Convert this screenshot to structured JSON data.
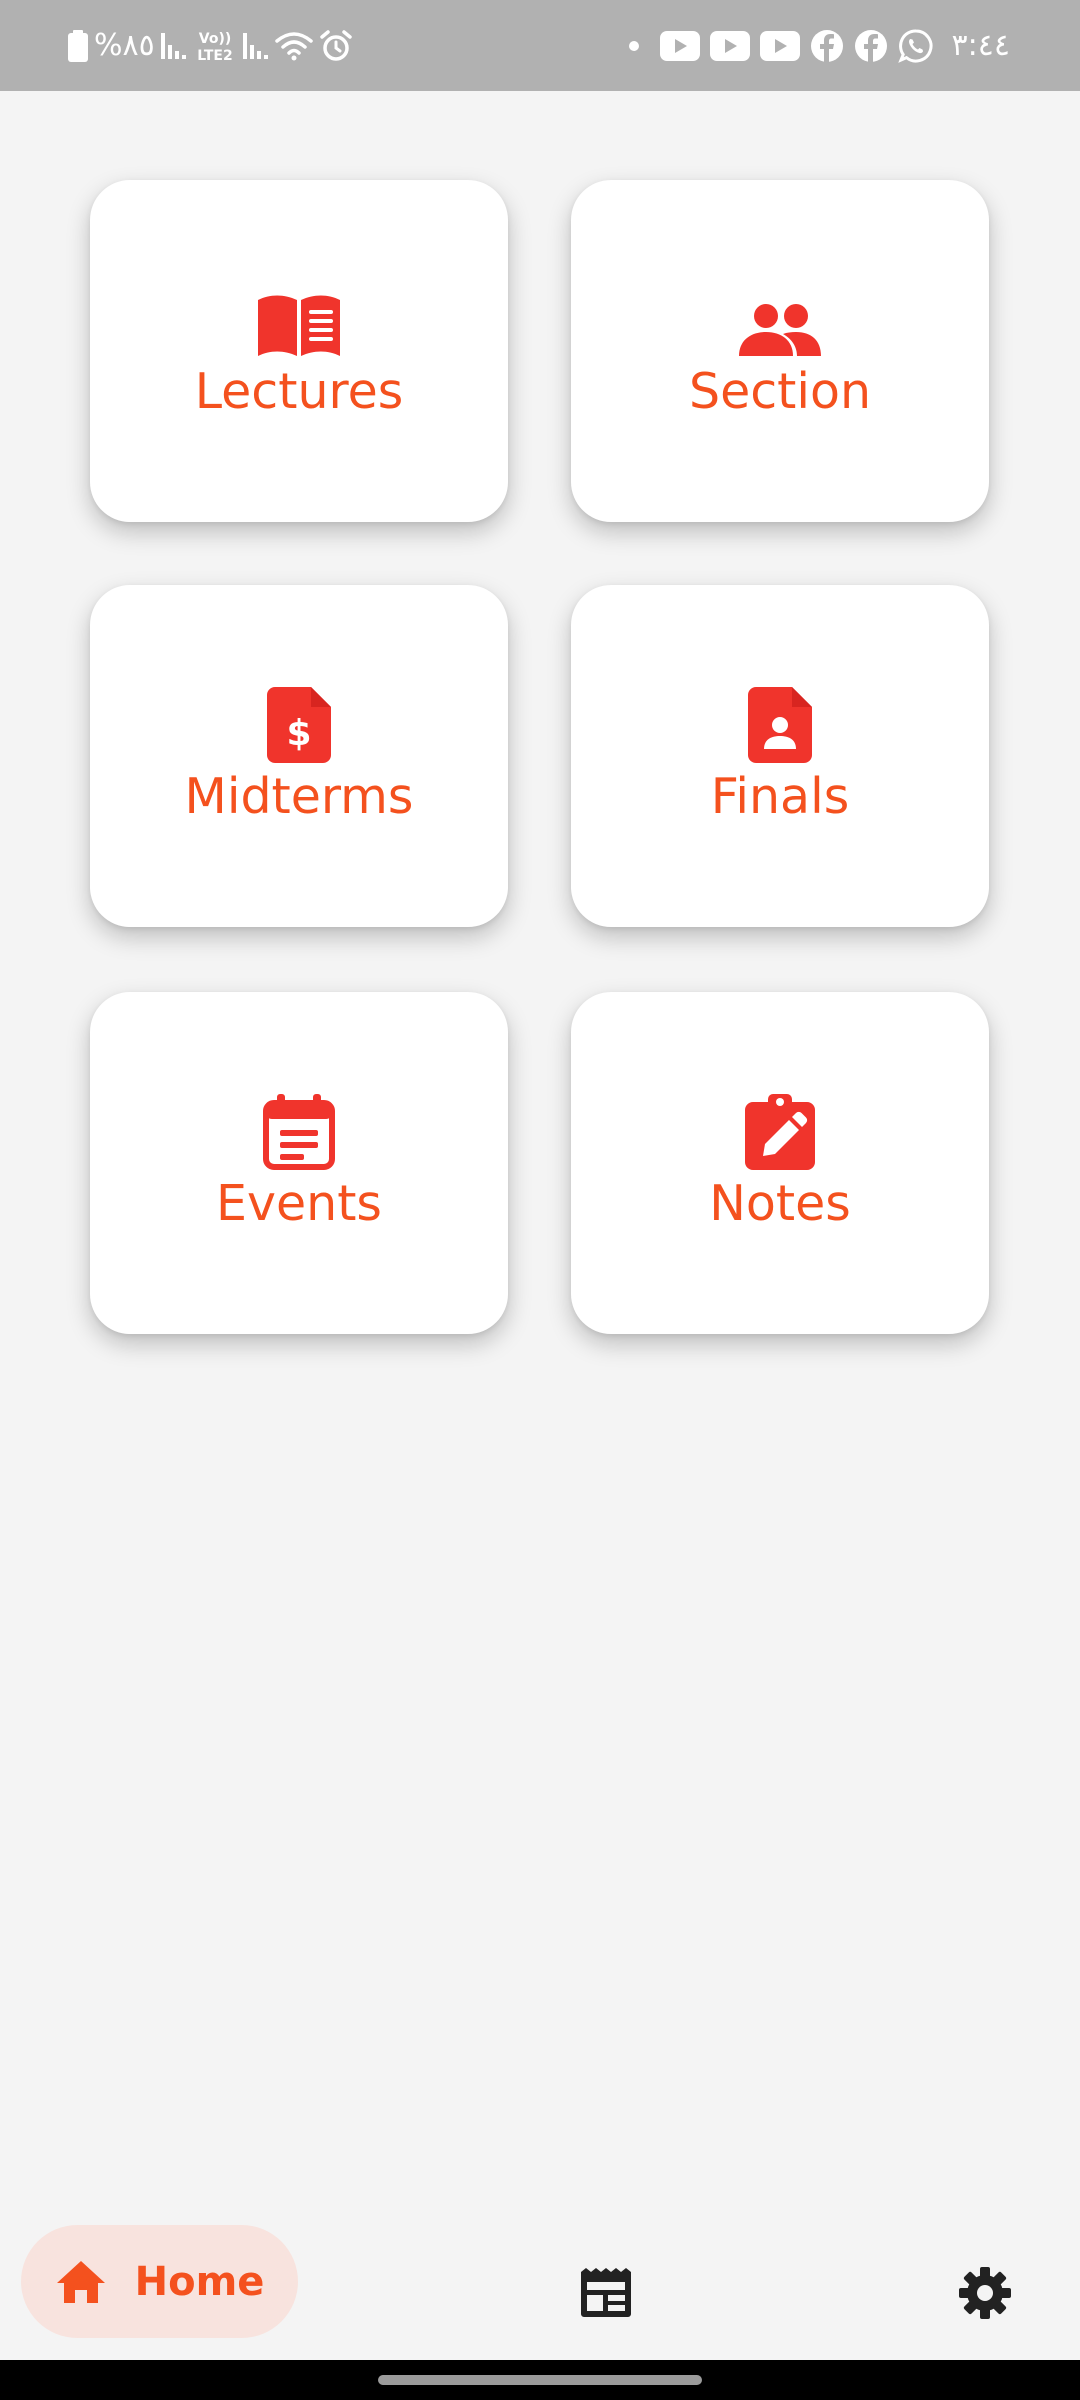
{
  "status_bar": {
    "battery_text": "%٨٥",
    "network_label": "Vo) LTE2",
    "clock": "٣:٤٤",
    "left_icons": [
      "battery-icon",
      "signal-icon",
      "volte-icon",
      "signal-icon",
      "wifi-icon",
      "alarm-icon"
    ],
    "right_icons": [
      "dot-icon",
      "youtube-icon",
      "youtube-icon",
      "youtube-icon",
      "facebook-icon",
      "facebook-icon",
      "whatsapp-icon"
    ]
  },
  "tiles": [
    {
      "label": "Lectures",
      "icon": "book-open-icon"
    },
    {
      "label": "Section",
      "icon": "people-icon"
    },
    {
      "label": "Midterms",
      "icon": "dollar-document-icon"
    },
    {
      "label": "Finals",
      "icon": "person-document-icon"
    },
    {
      "label": "Events",
      "icon": "calendar-icon"
    },
    {
      "label": "Notes",
      "icon": "clipboard-edit-icon"
    }
  ],
  "bottom_nav": {
    "home_label": "Home",
    "home_icon": "home-icon",
    "middle_icon": "newspaper-icon",
    "right_icon": "settings-gear-icon"
  },
  "colors": {
    "accent": "#f4511e",
    "icon_red": "#f0342c",
    "home_pill_bg": "#f8e3de",
    "status_bar_bg": "#b1b1b1",
    "background": "#f4f4f4",
    "nav_icon_dark": "#222222"
  }
}
